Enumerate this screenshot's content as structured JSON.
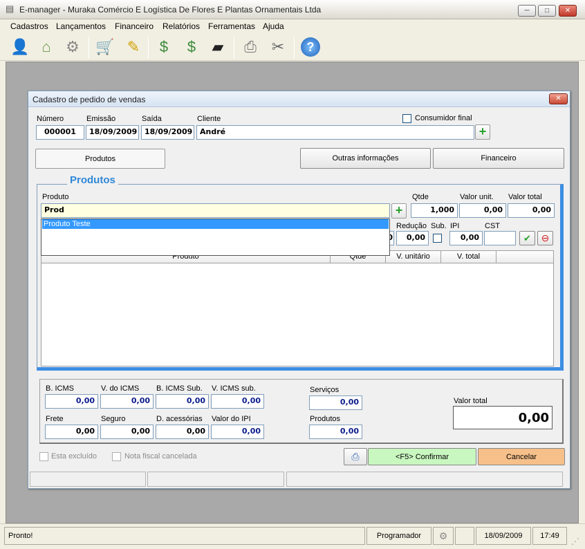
{
  "window": {
    "title": "E-manager - Muraka Comércio E Logística De Flores E Plantas Ornamentais Ltda",
    "minimize": "─",
    "maximize": "□",
    "close": "✕"
  },
  "menu": [
    "Cadastros",
    "Lançamentos",
    "Financeiro",
    "Relatórios",
    "Ferramentas",
    "Ajuda"
  ],
  "toolbar": {
    "icons": [
      "user-icon",
      "house-icon",
      "gears-icon",
      "cart-icon",
      "notepad-icon",
      "money-icon",
      "money-stack-icon",
      "book-icon",
      "printer-icon",
      "tools-icon",
      "help-icon"
    ]
  },
  "dialog": {
    "title": "Cadastro de pedido de vendas",
    "close": "✕",
    "labels": {
      "numero": "Número",
      "emissao": "Emissão",
      "saida": "Saída",
      "cliente": "Cliente",
      "consumidor": "Consumidor final"
    },
    "values": {
      "numero": "000001",
      "emissao": "18/09/2009",
      "saida": "18/09/2009",
      "cliente": "André"
    },
    "tabs": [
      "Produtos",
      "Outras informações",
      "Financeiro"
    ],
    "produtos": {
      "group_title": "Produtos",
      "labels": {
        "produto": "Produto",
        "qtde": "Qtde",
        "valor_unit": "Valor unit.",
        "valor_total": "Valor total",
        "reducao": "Redução",
        "sub": "Sub.",
        "ipi": "IPI",
        "cst": "CST"
      },
      "values": {
        "produto": "Prod",
        "qtde": "1,000",
        "valor_unit": "0,00",
        "valor_total": "0,00",
        "reducao_prev": "0",
        "reducao": "0,00",
        "ipi": "0,00",
        "cst": ""
      },
      "suggestions": [
        "Produto Teste"
      ],
      "grid_headers": [
        "Produto",
        "Qtde",
        "V. unitário",
        "V. total"
      ]
    },
    "totals": {
      "labels": {
        "b_icms": "B. ICMS",
        "v_icms": "V. do ICMS",
        "b_icms_sub": "B. ICMS Sub.",
        "v_icms_sub": "V. ICMS sub.",
        "servicos": "Serviços",
        "frete": "Frete",
        "seguro": "Seguro",
        "d_acessorias": "D. acessórias",
        "valor_ipi": "Valor do IPI",
        "produtos": "Produtos",
        "valor_total": "Valor total"
      },
      "values": {
        "b_icms": "0,00",
        "v_icms": "0,00",
        "b_icms_sub": "0,00",
        "v_icms_sub": "0,00",
        "servicos": "0,00",
        "frete": "0,00",
        "seguro": "0,00",
        "d_acessorias": "0,00",
        "valor_ipi": "0,00",
        "produtos": "0,00",
        "valor_total": "0,00"
      }
    },
    "footer": {
      "excluido": "Esta excluído",
      "nf_cancelada": "Nota fiscal cancelada",
      "confirmar": "<F5> Confirmar",
      "cancelar": "Cancelar"
    }
  },
  "statusbar": {
    "status": "Pronto!",
    "user": "Programador",
    "date": "18/09/2009",
    "time": "17:49"
  },
  "colors": {
    "confirm_bg": "#c9f7c0",
    "cancel_bg": "#f6c08a",
    "group_accent": "#3c8ee3",
    "selection": "#3399ff"
  }
}
